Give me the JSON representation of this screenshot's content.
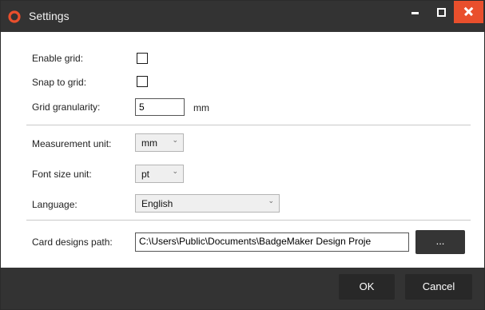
{
  "window": {
    "title": "Settings",
    "app_icon": "red-ring-icon",
    "controls": [
      "minimize-icon",
      "maximize-icon",
      "close-icon"
    ],
    "accent_color": "#e94f2c",
    "titlebar_color": "#333333"
  },
  "grid": {
    "enable_label": "Enable grid:",
    "enable_checked": false,
    "snap_label": "Snap to grid:",
    "snap_checked": false,
    "granularity_label": "Grid granularity:",
    "granularity_value": "5",
    "granularity_unit": "mm"
  },
  "units": {
    "measurement_label": "Measurement unit:",
    "measurement_value": "mm",
    "font_size_label": "Font size unit:",
    "font_size_value": "pt",
    "language_label": "Language:",
    "language_value": "English"
  },
  "paths": {
    "card_designs_label": "Card designs path:",
    "card_designs_value": "C:\\Users\\Public\\Documents\\BadgeMaker Design Proje",
    "browse_label": "..."
  },
  "footer": {
    "ok_label": "OK",
    "cancel_label": "Cancel"
  }
}
